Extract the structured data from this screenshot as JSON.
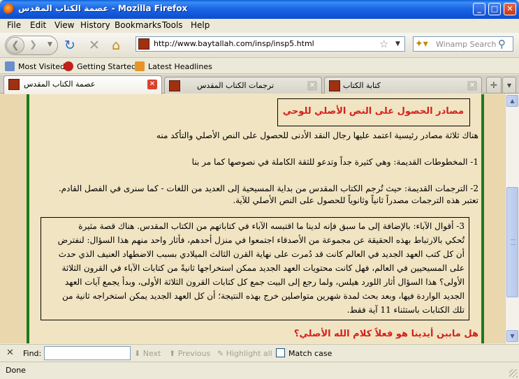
{
  "window": {
    "title": "عصمة الكتاب المقدس - Mozilla Firefox",
    "buttons": {
      "minimize": "_",
      "maximize": "□",
      "close": "✕"
    }
  },
  "menu": {
    "items": [
      "File",
      "Edit",
      "View",
      "History",
      "Bookmarks",
      "Tools",
      "Help"
    ]
  },
  "toolbar": {
    "back_icon": "back-arrow-icon",
    "forward_icon": "forward-arrow-icon",
    "reload_icon": "reload-icon",
    "stop_icon": "stop-icon",
    "home_icon": "home-icon",
    "url": "http://www.baytallah.com/insp/insp5.html",
    "search_placeholder": "Winamp Search"
  },
  "bookmarks": {
    "items": [
      "Most Visited",
      "Getting Started",
      "Latest Headlines"
    ]
  },
  "tabs": [
    {
      "label": "عصمة الكتاب المقدس",
      "active": true
    },
    {
      "label": "ترجمات الكتاب المقدس",
      "active": false
    },
    {
      "label": "كتابة الكتاب",
      "active": false
    }
  ],
  "page": {
    "heading": "مصادر الحصول على النص الأصلي للوحي",
    "intro": "هناك ثلاثة مصادر رئيسية اعتمد عليها رجال النقد الأدنى للحصول على النص الأصلي والتأكد منه",
    "point1": "1- المخطوطات القديمة: وهي كثيرة جداً وتدعو للثقة الكاملة في نصوصها كما مر بنا",
    "point2_line1": "2- الترجمات القديمة: حيث تُرجم الكتاب المقدس من بداية المسيحية إلى العديد من اللغات - كما سنرى في الفصل القادم.",
    "point2_line2": "تعتبر هذه الترجمات مصدراً ثانياً وثانوياً للحصول على النص الأصلي للآية.",
    "point3_lines": [
      "3- أقوال الآباء: بالإضافة إلى ما سبق فإنه لدينا ما اقتبسه الآباء في كتاباتهم من الكتاب المقدس. هناك قصة مثيرة",
      "تُحكي بالارتباط بهذه الحقيقة عن مجموعة من الأصدقاء اجتمعوا في منزل أحدهم، فأثار واحد منهم هذا السؤال: لنفترض",
      "أن كل كتب العهد الجديد في العالم كانت قد دُمرت على نهاية القرن الثالث الميلادي بسبب الاضطهاد العنيف الذي حدث",
      "على المسيحيين في العالم، فهل كانت محتويات العهد الجديد ممكن استخراجها ثانيةً من كتابات الآباء في القرون الثلاثة",
      "الأولى؟ هذا السؤال أثار اللورد هيلس، ولما رجع إلى البيت جمع كل كتابات القرون الثلاثة الأولى، وبدأ يجمع آيات العهد",
      "الجديد الواردة فيها، وبعد بحث لمدة شهرين متواصلين خرج بهذه النتيجة؛ أن كل العهد الجديد يمكن استخراجه ثانية من",
      "تلك الكتابات باستثناء 11 آية فقط."
    ],
    "question": "هل ماببن أيدينا هو فعلاً كلام الله الأصلي؟"
  },
  "findbar": {
    "close": "✕",
    "label": "Find:",
    "value": "",
    "next": "Next",
    "previous": "Previous",
    "highlight": "Highlight all",
    "match_case": "Match case"
  },
  "status": {
    "text": "Done"
  },
  "colors": {
    "titlebar": "#1B66E4",
    "heading_red": "#D41F1F",
    "page_bg": "#F1E4C2",
    "border_green": "#1C7A1C"
  }
}
